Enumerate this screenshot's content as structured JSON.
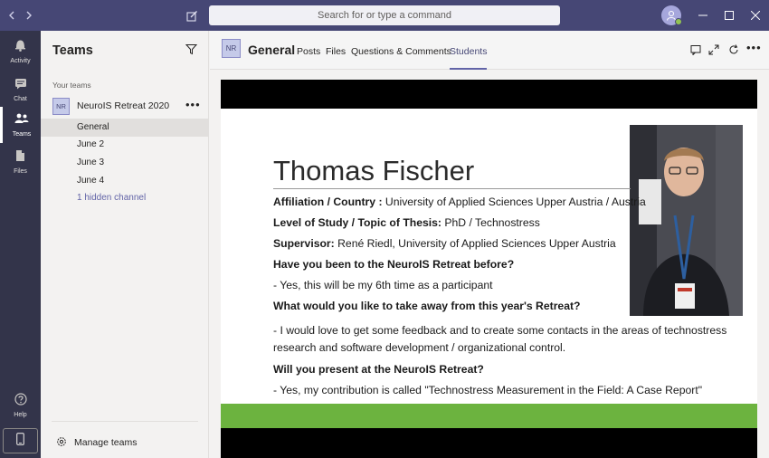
{
  "titlebar": {
    "search_placeholder": "Search for or type a command",
    "back_icon": "chevron-left-icon",
    "forward_icon": "chevron-right-icon",
    "compose_icon": "compose-icon",
    "status_color": "#92c353"
  },
  "rail": {
    "items": [
      {
        "label": "Activity",
        "icon": "bell-icon"
      },
      {
        "label": "Chat",
        "icon": "chat-icon"
      },
      {
        "label": "Teams",
        "icon": "teams-icon",
        "active": true
      },
      {
        "label": "Files",
        "icon": "files-icon"
      },
      {
        "label": "Help",
        "icon": "help-icon"
      }
    ]
  },
  "teams_panel": {
    "title": "Teams",
    "section_label": "Your teams",
    "team": {
      "initials": "NR",
      "name": "NeuroIS Retreat 2020"
    },
    "channels": [
      {
        "label": "General",
        "active": true
      },
      {
        "label": "June 2"
      },
      {
        "label": "June 3"
      },
      {
        "label": "June 4"
      },
      {
        "label": "1 hidden channel"
      }
    ],
    "manage_label": "Manage teams"
  },
  "header": {
    "initials": "NR",
    "channel_name": "General",
    "tabs": [
      "Posts",
      "Files",
      "Questions & Comments",
      "Students"
    ],
    "active_tab": "Students"
  },
  "slide": {
    "name": "Thomas Fischer",
    "affiliation_label": "Affiliation / Country :",
    "affiliation_value": " University of Applied Sciences Upper Austria / Austria",
    "level_label": "Level of Study / Topic of Thesis:",
    "level_value": " PhD / Technostress",
    "supervisor_label": "Supervisor:",
    "supervisor_value": " René Riedl, University of Applied Sciences Upper Austria",
    "q1": "Have you been to the NeuroIS Retreat before?",
    "a1": "- Yes, this will be my 6th time as a participant",
    "q2": "What would you like to take away from this year's Retreat?",
    "a2": "- I would love to get some feedback and to create some contacts in the areas of technostress research and software development / organizational control.",
    "q3": "Will you present at the NeuroIS Retreat?",
    "a3": "- Yes, my contribution is called \"Technostress Measurement in the Field: A Case Report\"",
    "accent_color": "#6cb33f"
  }
}
